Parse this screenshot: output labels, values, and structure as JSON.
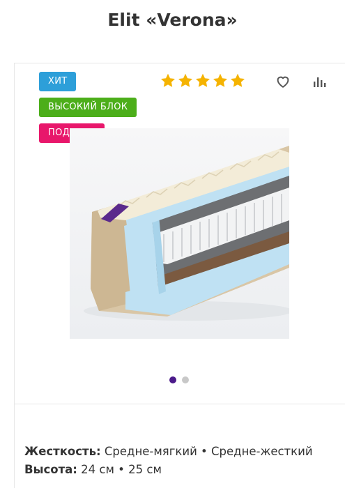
{
  "product": {
    "title": "Elit «Verona»",
    "rating": 5
  },
  "badges": [
    {
      "label": "ХИТ",
      "color": "#2d9fd9"
    },
    {
      "label": "ВЫСОКИЙ БЛОК",
      "color": "#4cae1a"
    },
    {
      "label": "ПОДАРОК",
      "color": "#e8176b"
    }
  ],
  "actions": {
    "favorite_icon": "heart-icon",
    "compare_icon": "bar-chart-icon"
  },
  "gallery": {
    "slides": 2,
    "active_slide": 1,
    "dot_active_color": "#4b1a8a",
    "dot_inactive_color": "#c8c8c8"
  },
  "specs": {
    "firmness": {
      "label": "Жесткость:",
      "value": " Средне-мягкий • Средне-жесткий"
    },
    "height": {
      "label": "Высота:",
      "value": " 24 см • 25 см"
    }
  },
  "colors": {
    "star": "#f5b301",
    "icon": "#555555"
  }
}
